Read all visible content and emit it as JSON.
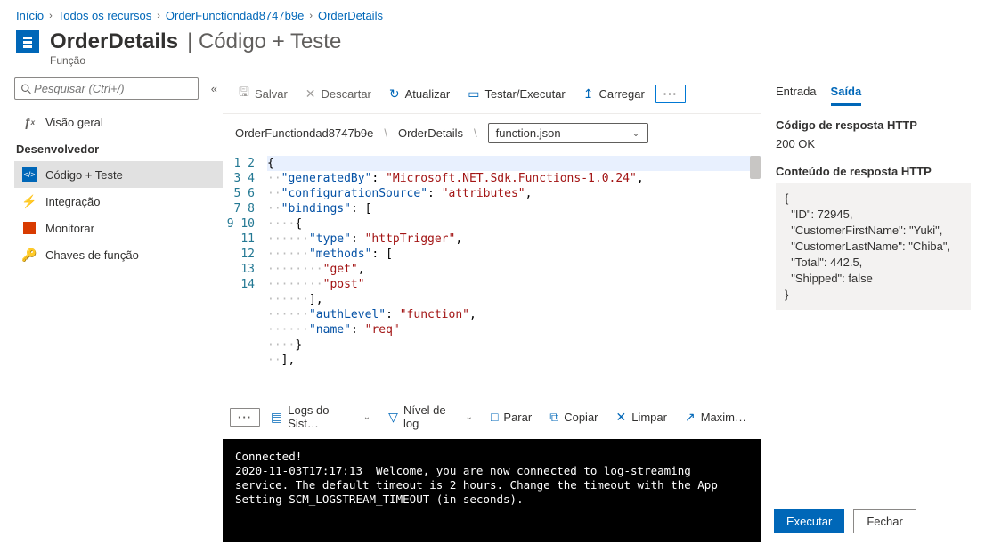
{
  "breadcrumbs": {
    "home": "Início",
    "all": "Todos os recursos",
    "fnapp": "OrderFunctiondad8747b9e",
    "fn": "OrderDetails"
  },
  "title": {
    "name": "OrderDetails",
    "suffix": "Código + Teste",
    "caption": "Função"
  },
  "search": {
    "placeholder": "Pesquisar (Ctrl+/)"
  },
  "sidebar": {
    "overview": "Visão geral",
    "devHeader": "Desenvolvedor",
    "items": {
      "code": "Código + Teste",
      "integration": "Integração",
      "monitor": "Monitorar",
      "keys": "Chaves de função"
    }
  },
  "toolbar": {
    "save": "Salvar",
    "discard": "Descartar",
    "refresh": "Atualizar",
    "test": "Testar/Executar",
    "upload": "Carregar"
  },
  "path": {
    "app": "OrderFunctiondad8747b9e",
    "fn": "OrderDetails",
    "file": "function.json"
  },
  "code": {
    "l1": "{",
    "l2a": "\"generatedBy\"",
    "l2b": "\"Microsoft.NET.Sdk.Functions-1.0.24\"",
    "l3a": "\"configurationSource\"",
    "l3b": "\"attributes\"",
    "l4a": "\"bindings\"",
    "l5": "{",
    "l6a": "\"type\"",
    "l6b": "\"httpTrigger\"",
    "l7a": "\"methods\"",
    "l8": "\"get\"",
    "l9": "\"post\"",
    "l10": "],",
    "l11a": "\"authLevel\"",
    "l11b": "\"function\"",
    "l12a": "\"name\"",
    "l12b": "\"req\"",
    "l13": "}",
    "l14": "],"
  },
  "logbar": {
    "logs": "Logs do Sist…",
    "level": "Nível de log",
    "stop": "Parar",
    "copy": "Copiar",
    "clear": "Limpar",
    "max": "Maxim…"
  },
  "console": {
    "connected": "Connected!",
    "msg": "2020-11-03T17:17:13  Welcome, you are now connected to log-streaming service. The default timeout is 2 hours. Change the timeout with the App Setting SCM_LOGSTREAM_TIMEOUT (in seconds)."
  },
  "right": {
    "tabIn": "Entrada",
    "tabOut": "Saída",
    "codeLabel": "Código de resposta HTTP",
    "codeValue": "200 OK",
    "contentLabel": "Conteúdo de resposta HTTP",
    "body": "{\n  \"ID\": 72945,\n  \"CustomerFirstName\": \"Yuki\",\n  \"CustomerLastName\": \"Chiba\",\n  \"Total\": 442.5,\n  \"Shipped\": false\n}",
    "run": "Executar",
    "close": "Fechar"
  }
}
